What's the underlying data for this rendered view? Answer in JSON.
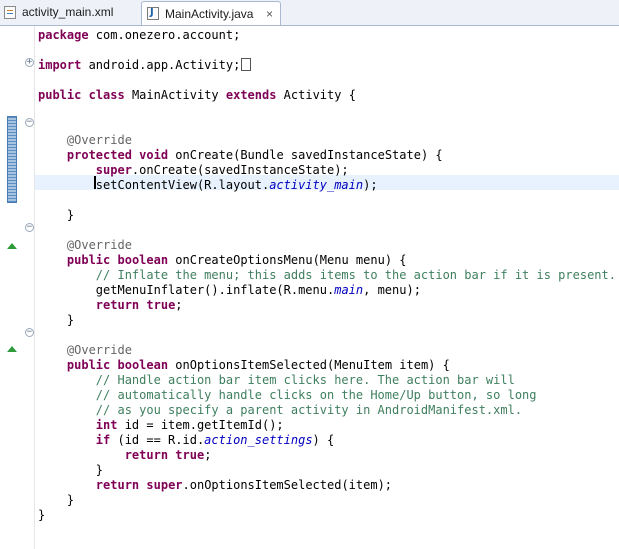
{
  "tabs": [
    {
      "label": "activity_main.xml",
      "icon": "xml-file-icon"
    },
    {
      "label": "MainActivity.java",
      "icon": "java-file-icon",
      "active": true,
      "close": "×"
    }
  ],
  "editor": {
    "current_line": 11,
    "lines": [
      [
        {
          "t": "kw",
          "v": "package"
        },
        {
          "t": "p",
          "v": " com.onezero.account;"
        }
      ],
      [],
      [
        {
          "t": "kw",
          "v": "import"
        },
        {
          "t": "p",
          "v": " android.app.Activity;"
        },
        {
          "t": "box",
          "v": ""
        }
      ],
      [],
      [
        {
          "t": "kw",
          "v": "public"
        },
        {
          "t": "p",
          "v": " "
        },
        {
          "t": "kw",
          "v": "class"
        },
        {
          "t": "p",
          "v": " MainActivity "
        },
        {
          "t": "kw",
          "v": "extends"
        },
        {
          "t": "p",
          "v": " Activity {"
        }
      ],
      [],
      [],
      [
        {
          "t": "p",
          "v": "    "
        },
        {
          "t": "ann",
          "v": "@Override"
        }
      ],
      [
        {
          "t": "p",
          "v": "    "
        },
        {
          "t": "kw",
          "v": "protected"
        },
        {
          "t": "p",
          "v": " "
        },
        {
          "t": "kw",
          "v": "void"
        },
        {
          "t": "p",
          "v": " onCreate(Bundle savedInstanceState) {"
        }
      ],
      [
        {
          "t": "p",
          "v": "        "
        },
        {
          "t": "kw",
          "v": "super"
        },
        {
          "t": "p",
          "v": ".onCreate(savedInstanceState);"
        }
      ],
      [
        {
          "t": "p",
          "v": "        setContentView(R.layout."
        },
        {
          "t": "fld",
          "v": "activity_main"
        },
        {
          "t": "p",
          "v": ");"
        }
      ],
      [],
      [
        {
          "t": "p",
          "v": "    }"
        }
      ],
      [],
      [
        {
          "t": "p",
          "v": "    "
        },
        {
          "t": "ann",
          "v": "@Override"
        }
      ],
      [
        {
          "t": "p",
          "v": "    "
        },
        {
          "t": "kw",
          "v": "public"
        },
        {
          "t": "p",
          "v": " "
        },
        {
          "t": "kw",
          "v": "boolean"
        },
        {
          "t": "p",
          "v": " onCreateOptionsMenu(Menu menu) {"
        }
      ],
      [
        {
          "t": "p",
          "v": "        "
        },
        {
          "t": "cmt",
          "v": "// Inflate the menu; this adds items to the action bar if it is present."
        }
      ],
      [
        {
          "t": "p",
          "v": "        getMenuInflater().inflate(R.menu."
        },
        {
          "t": "fld",
          "v": "main"
        },
        {
          "t": "p",
          "v": ", menu);"
        }
      ],
      [
        {
          "t": "p",
          "v": "        "
        },
        {
          "t": "kw",
          "v": "return"
        },
        {
          "t": "p",
          "v": " "
        },
        {
          "t": "kw",
          "v": "true"
        },
        {
          "t": "p",
          "v": ";"
        }
      ],
      [
        {
          "t": "p",
          "v": "    }"
        }
      ],
      [],
      [
        {
          "t": "p",
          "v": "    "
        },
        {
          "t": "ann",
          "v": "@Override"
        }
      ],
      [
        {
          "t": "p",
          "v": "    "
        },
        {
          "t": "kw",
          "v": "public"
        },
        {
          "t": "p",
          "v": " "
        },
        {
          "t": "kw",
          "v": "boolean"
        },
        {
          "t": "p",
          "v": " onOptionsItemSelected(MenuItem item) {"
        }
      ],
      [
        {
          "t": "p",
          "v": "        "
        },
        {
          "t": "cmt",
          "v": "// Handle action bar item clicks here. The action bar will"
        }
      ],
      [
        {
          "t": "p",
          "v": "        "
        },
        {
          "t": "cmt",
          "v": "// automatically handle clicks on the Home/Up button, so long"
        }
      ],
      [
        {
          "t": "p",
          "v": "        "
        },
        {
          "t": "cmt",
          "v": "// as you specify a parent activity in AndroidManifest.xml."
        }
      ],
      [
        {
          "t": "p",
          "v": "        "
        },
        {
          "t": "kw",
          "v": "int"
        },
        {
          "t": "p",
          "v": " id = item.getItemId();"
        }
      ],
      [
        {
          "t": "p",
          "v": "        "
        },
        {
          "t": "kw",
          "v": "if"
        },
        {
          "t": "p",
          "v": " (id == R.id."
        },
        {
          "t": "fld",
          "v": "action_settings"
        },
        {
          "t": "p",
          "v": ") {"
        }
      ],
      [
        {
          "t": "p",
          "v": "            "
        },
        {
          "t": "kw",
          "v": "return"
        },
        {
          "t": "p",
          "v": " "
        },
        {
          "t": "kw",
          "v": "true"
        },
        {
          "t": "p",
          "v": ";"
        }
      ],
      [
        {
          "t": "p",
          "v": "        }"
        }
      ],
      [
        {
          "t": "p",
          "v": "        "
        },
        {
          "t": "kw",
          "v": "return"
        },
        {
          "t": "p",
          "v": " "
        },
        {
          "t": "kw",
          "v": "super"
        },
        {
          "t": "p",
          "v": ".onOptionsItemSelected(item);"
        }
      ],
      [
        {
          "t": "p",
          "v": "    }"
        }
      ],
      [
        {
          "t": "p",
          "v": "}"
        }
      ]
    ]
  },
  "gutter": {
    "fold_expand_glyph": "+",
    "fold_collapse_glyph": "−"
  },
  "colors": {
    "keyword": "#7f0055",
    "annotation": "#646464",
    "comment": "#3f7f5f",
    "field": "#0000c0",
    "current_line": "#e8f2fe"
  }
}
